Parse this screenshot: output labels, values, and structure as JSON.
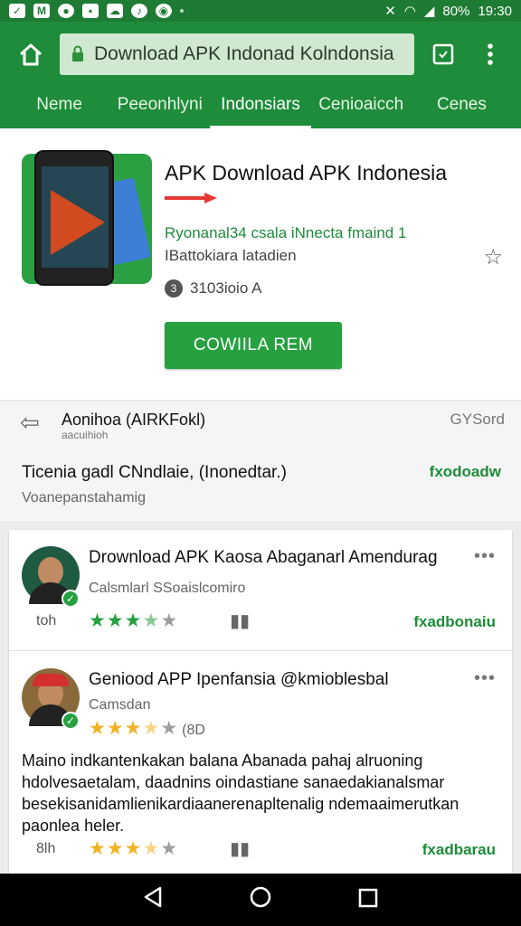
{
  "status": {
    "battery": "80%",
    "time": "19:30"
  },
  "toolbar": {
    "url": "Download APK Indonad Kolndonsia"
  },
  "tabs": [
    {
      "label": "Neme"
    },
    {
      "label": "Peeonhlyni"
    },
    {
      "label": "Indonsiars",
      "active": true
    },
    {
      "label": "Cenioaicch"
    },
    {
      "label": "Cenes"
    }
  ],
  "hero": {
    "title": "APK Download APK Indonesia",
    "developer": "Ryonanal34 csala iNnecta fmaind 1",
    "category": "IBattokiara latadien",
    "age": "3103ioio A",
    "install_label": "COWIILA REM"
  },
  "section": {
    "title": "Aonihoa (AIRKFokl)",
    "subtitle": "aacuihioh",
    "right": "GYSord",
    "heading": "Ticenia gadl CNndlaie, (Inonedtar.)",
    "link": "fxodoadw",
    "desc": "Voanepanstahamig"
  },
  "items": [
    {
      "title": "Drownload APK Kaosa Abaganarl Amendurag",
      "subtitle": "Calsmlarl SSoaislcomiro",
      "meta_left": "toh",
      "rating_stars": 3.5,
      "link": "fxadbonaiu"
    },
    {
      "title": "Geniood APP Ipenfansia @kmioblesbal",
      "subtitle": "Camsdan",
      "rating_stars": 3.5,
      "rating_count": "(8D",
      "body": "Maino indkantenkakan balana Abanada pahaj alruoning hdolvesaetalam, daadnins oindastiane sanaedakianalsmar besekisanidamlienikardiaanerenapltenalig ndemaaimerutkan paonlea heler.",
      "meta_left": "8lh",
      "link": "fxadbarau"
    }
  ],
  "colors": {
    "brand": "#1e8c3a",
    "accent": "#27a03f",
    "star": "#f0b323"
  }
}
